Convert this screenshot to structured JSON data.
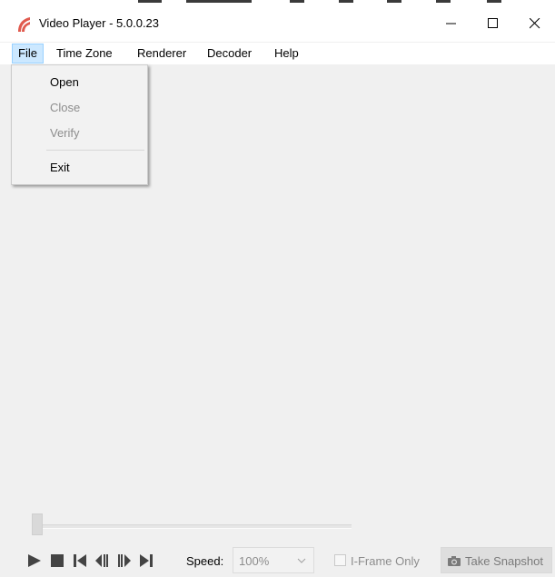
{
  "window": {
    "title": "Video Player - 5.0.0.23"
  },
  "menubar": {
    "items": [
      {
        "label": "File"
      },
      {
        "label": "Time Zone"
      },
      {
        "label": "Renderer"
      },
      {
        "label": "Decoder"
      },
      {
        "label": "Help"
      }
    ]
  },
  "file_menu": {
    "items": [
      {
        "label": "Open",
        "enabled": true
      },
      {
        "label": "Close",
        "enabled": false
      },
      {
        "label": "Verify",
        "enabled": false
      },
      {
        "label": "Exit",
        "enabled": true
      }
    ]
  },
  "controls": {
    "icons": [
      "play-icon",
      "stop-icon",
      "skip-to-start-icon",
      "step-back-icon",
      "step-forward-icon",
      "skip-to-end-icon"
    ],
    "speed_label": "Speed:",
    "speed_value": "100%",
    "iframe_only_label": "I-Frame Only",
    "iframe_only_checked": false,
    "snapshot_label": "Take Snapshot"
  },
  "seek": {
    "position": 0
  },
  "colors": {
    "menu_highlight": "#cce8ff",
    "disabled_text": "#8d8d8d",
    "app_icon": "#e05a4e"
  }
}
